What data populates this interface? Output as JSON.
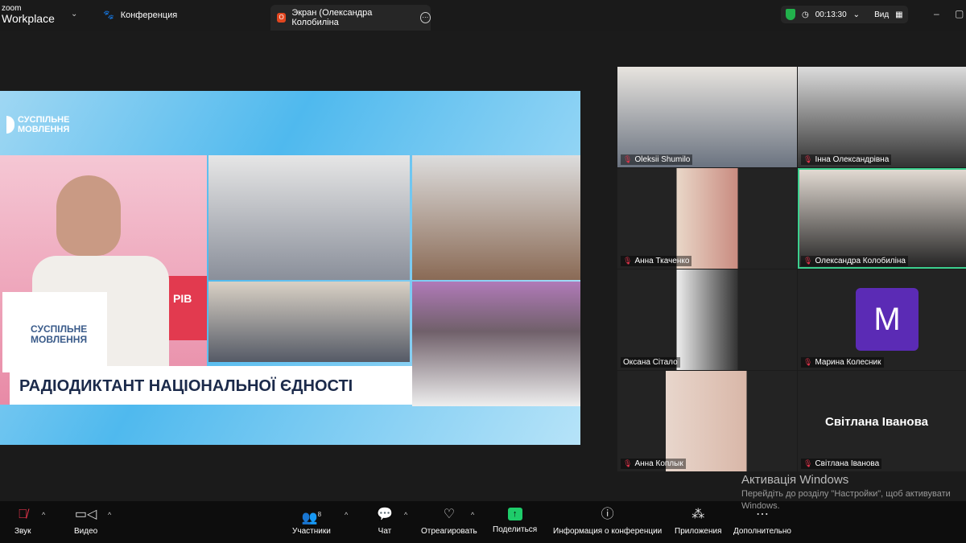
{
  "app": {
    "logo_small": "zoom",
    "logo_big": "Workplace",
    "meeting_label": "Конференция"
  },
  "screen_tab": {
    "badge": "О",
    "label": "Экран (Олександра Колобиліна"
  },
  "status": {
    "timer": "00:13:30",
    "view_label": "Вид"
  },
  "shared": {
    "brand_line1": "СУСПІЛЬНЕ",
    "brand_line2": "МОВЛЕННЯ",
    "banner": "РАДІОДИКТАНТ НАЦІОНАЛЬНОЇ ЄДНОСТІ",
    "card_line1": "СУСПІЛЬНЕ",
    "card_line2": "МОВЛЕННЯ",
    "sign": "РІВ"
  },
  "participants": [
    {
      "name": "Oleksii Shumilo",
      "muted": true
    },
    {
      "name": "Інна Олександрівна",
      "muted": true
    },
    {
      "name": "Анна Ткаченко",
      "muted": true
    },
    {
      "name": "Олександра Колобиліна",
      "muted": true,
      "active": true
    },
    {
      "name": "Оксана Сітало",
      "muted": false
    },
    {
      "name": "Марина Колесник",
      "muted": true,
      "avatar": "M",
      "avatar_color": "#5b2bb5"
    },
    {
      "name": "Анна Коплык",
      "muted": true
    },
    {
      "name": "Світлана Іванова",
      "muted": true
    }
  ],
  "watermark": {
    "title": "Активація Windows",
    "text": "Перейдіть до розділу \"Настройки\", щоб активувати",
    "text2": "Windows."
  },
  "toolbar": {
    "audio": "Звук",
    "video": "Видео",
    "participants": "Участники",
    "participants_count": "8",
    "chat": "Чат",
    "react": "Отреагировать",
    "share": "Поделиться",
    "info": "Информация о конференции",
    "apps": "Приложения",
    "more": "Дополнительно"
  }
}
